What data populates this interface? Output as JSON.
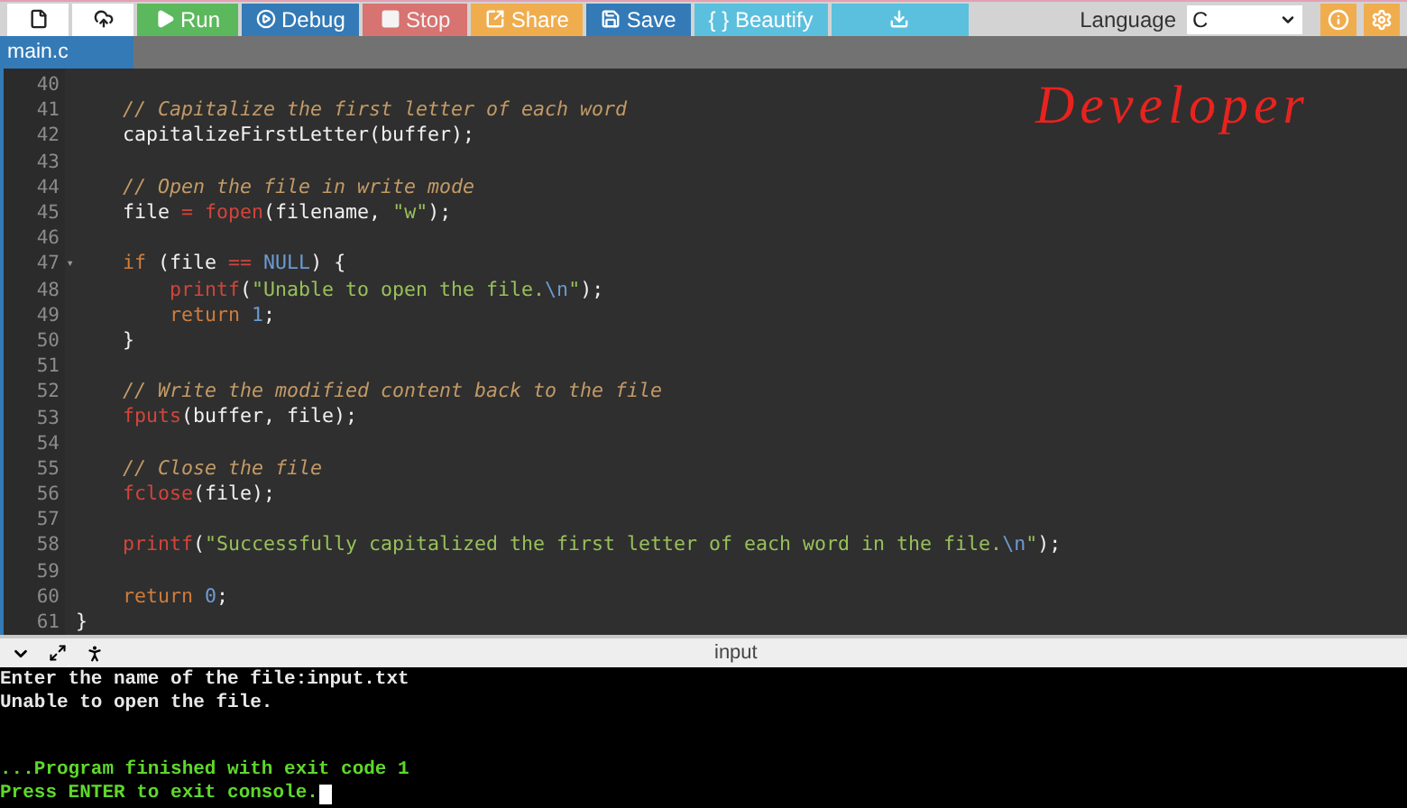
{
  "toolbar": {
    "buttons": [
      {
        "kind": "new",
        "disabled": false
      },
      {
        "kind": "upload",
        "disabled": false
      },
      {
        "kind": "run",
        "label": "Run",
        "disabled": false
      },
      {
        "kind": "debug",
        "label": "Debug",
        "disabled": false
      },
      {
        "kind": "stop",
        "label": "Stop",
        "disabled": true
      },
      {
        "kind": "share",
        "label": "Share",
        "disabled": false
      },
      {
        "kind": "save",
        "label": "Save",
        "disabled": false
      },
      {
        "kind": "beautify",
        "label": "{ } Beautify",
        "disabled": false
      },
      {
        "kind": "download",
        "disabled": false
      }
    ],
    "language_label": "Language",
    "language_value": "C"
  },
  "tabs": [
    {
      "label": "main.c",
      "selected": true
    }
  ],
  "annotation": "Developer",
  "editor": {
    "lines": [
      {
        "number": "40"
      },
      {
        "number": "41",
        "tokens": [
          {
            "kind": "comment",
            "text": "    // Capitalize the first letter of each word"
          }
        ]
      },
      {
        "number": "42",
        "tokens": [
          {
            "kind": "plain",
            "text": "    capitalizeFirstLetter(buffer);"
          }
        ]
      },
      {
        "number": "43"
      },
      {
        "number": "44",
        "tokens": [
          {
            "kind": "comment",
            "text": "    // Open the file in write mode"
          }
        ]
      },
      {
        "number": "45",
        "tokens": [
          {
            "kind": "plain",
            "text": "    file "
          },
          {
            "kind": "operator",
            "text": "="
          },
          {
            "kind": "function",
            "text": " fopen"
          },
          {
            "kind": "plain",
            "text": "(filename, "
          },
          {
            "kind": "string",
            "text": "\"w\""
          },
          {
            "kind": "plain",
            "text": ");"
          }
        ]
      },
      {
        "number": "46"
      },
      {
        "number": "47",
        "fold_marker": "▾",
        "tokens": [
          {
            "kind": "keyword",
            "text": "    if"
          },
          {
            "kind": "plain",
            "text": " (file "
          },
          {
            "kind": "operator",
            "text": "=="
          },
          {
            "kind": "constant",
            "text": " NULL"
          },
          {
            "kind": "plain",
            "text": ") {"
          }
        ]
      },
      {
        "number": "48",
        "tokens": [
          {
            "kind": "function",
            "text": "        printf"
          },
          {
            "kind": "plain",
            "text": "("
          },
          {
            "kind": "string",
            "text": "\"Unable to open the file."
          },
          {
            "kind": "constant",
            "text": "\\n"
          },
          {
            "kind": "string",
            "text": "\""
          },
          {
            "kind": "plain",
            "text": ");"
          }
        ]
      },
      {
        "number": "49",
        "tokens": [
          {
            "kind": "keyword",
            "text": "        return"
          },
          {
            "kind": "constant",
            "text": " 1"
          },
          {
            "kind": "plain",
            "text": ";"
          }
        ]
      },
      {
        "number": "50",
        "tokens": [
          {
            "kind": "plain",
            "text": "    }"
          }
        ]
      },
      {
        "number": "51"
      },
      {
        "number": "52",
        "tokens": [
          {
            "kind": "comment",
            "text": "    // Write the modified content back to the file"
          }
        ]
      },
      {
        "number": "53",
        "tokens": [
          {
            "kind": "function",
            "text": "    fputs"
          },
          {
            "kind": "plain",
            "text": "(buffer, file);"
          }
        ]
      },
      {
        "number": "54"
      },
      {
        "number": "55",
        "tokens": [
          {
            "kind": "comment",
            "text": "    // Close the file"
          }
        ]
      },
      {
        "number": "56",
        "tokens": [
          {
            "kind": "function",
            "text": "    fclose"
          },
          {
            "kind": "plain",
            "text": "(file);"
          }
        ]
      },
      {
        "number": "57"
      },
      {
        "number": "58",
        "tokens": [
          {
            "kind": "function",
            "text": "    printf"
          },
          {
            "kind": "plain",
            "text": "("
          },
          {
            "kind": "string",
            "text": "\"Successfully capitalized the first letter of each word in the file."
          },
          {
            "kind": "constant",
            "text": "\\n"
          },
          {
            "kind": "string",
            "text": "\""
          },
          {
            "kind": "plain",
            "text": ");"
          }
        ]
      },
      {
        "number": "59"
      },
      {
        "number": "60",
        "tokens": [
          {
            "kind": "keyword",
            "text": "    return"
          },
          {
            "kind": "constant",
            "text": " 0"
          },
          {
            "kind": "plain",
            "text": ";"
          }
        ]
      },
      {
        "number": "61",
        "tokens": [
          {
            "kind": "plain",
            "text": "}"
          }
        ]
      }
    ]
  },
  "console": {
    "title": "input",
    "cursor_visible": true,
    "lines": [
      {
        "kind": "output",
        "text": "Enter the name of the file:input.txt"
      },
      {
        "kind": "output",
        "text": "Unable to open the file."
      },
      {
        "kind": "status",
        "text": "...Program finished with exit code 1"
      },
      {
        "kind": "status",
        "text": "Press ENTER to exit console."
      }
    ]
  }
}
